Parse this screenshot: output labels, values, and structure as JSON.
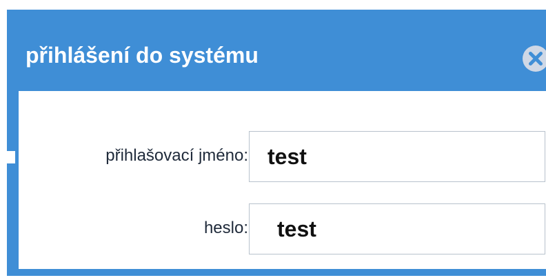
{
  "dialog": {
    "title": "přihlášení do systému",
    "close_icon": "close-circle-icon"
  },
  "form": {
    "username": {
      "label": "přihlašovací jméno:",
      "value": "test"
    },
    "password": {
      "label": "heslo:",
      "value": "test"
    }
  },
  "colors": {
    "titlebar": "#3f8ed6",
    "title_text": "#ffffff",
    "close_button": "#cfd8e6",
    "label_text": "#1f2a3a"
  }
}
